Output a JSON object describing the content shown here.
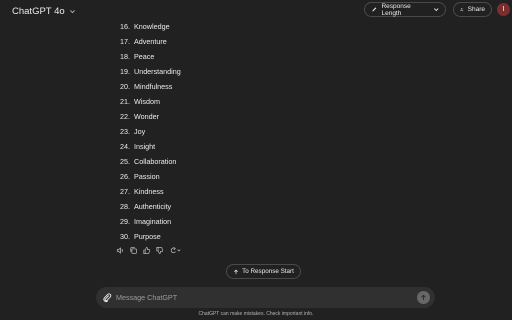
{
  "header": {
    "model_name": "ChatGPT 4o",
    "response_length_label": "Response Length",
    "share_label": "Share",
    "avatar_initial": "I"
  },
  "list": [
    {
      "num": "16.",
      "text": "Knowledge"
    },
    {
      "num": "17.",
      "text": "Adventure"
    },
    {
      "num": "18.",
      "text": "Peace"
    },
    {
      "num": "19.",
      "text": "Understanding"
    },
    {
      "num": "20.",
      "text": "Mindfulness"
    },
    {
      "num": "21.",
      "text": "Wisdom"
    },
    {
      "num": "22.",
      "text": "Wonder"
    },
    {
      "num": "23.",
      "text": "Joy"
    },
    {
      "num": "24.",
      "text": "Insight"
    },
    {
      "num": "25.",
      "text": "Collaboration"
    },
    {
      "num": "26.",
      "text": "Passion"
    },
    {
      "num": "27.",
      "text": "Kindness"
    },
    {
      "num": "28.",
      "text": "Authenticity"
    },
    {
      "num": "29.",
      "text": "Imagination"
    },
    {
      "num": "30.",
      "text": "Purpose"
    }
  ],
  "actions": {
    "icons": [
      "read-aloud-icon",
      "copy-icon",
      "thumbs-up-icon",
      "thumbs-down-icon",
      "regenerate-icon"
    ]
  },
  "jump": {
    "label": "To Response Start"
  },
  "composer": {
    "placeholder": "Message ChatGPT"
  },
  "footer": {
    "disclaimer": "ChatGPT can make mistakes. Check important info."
  },
  "colors": {
    "background": "#212121",
    "composer": "#303030",
    "avatar": "#7a2e2e",
    "text": "#ececec"
  }
}
